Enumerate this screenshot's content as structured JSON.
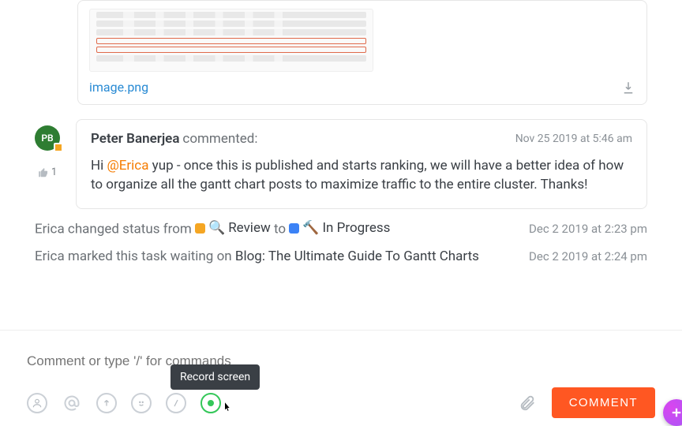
{
  "attachment": {
    "filename": "image.png"
  },
  "comment": {
    "avatar_initials": "PB",
    "author": "Peter Banerjea",
    "verb": "commented:",
    "timestamp": "Nov 25 2019 at 5:46 am",
    "body_prefix": "Hi ",
    "mention": "@Erica",
    "body_suffix": " yup - once this is published and starts ranking, we will have a better idea of how to organize all the gantt chart posts to maximize traffic to the entire cluster. Thanks!",
    "like_count": "1"
  },
  "activity1": {
    "actor": "Erica",
    "verb": " changed status from ",
    "from_status": "Review",
    "to_word": " to ",
    "to_status": "In Progress",
    "time": "Dec 2 2019 at 2:23 pm"
  },
  "activity2": {
    "actor": "Erica",
    "verb": " marked this task waiting on ",
    "target": "Blog: The Ultimate Guide To Gantt Charts",
    "time": "Dec 2 2019 at 2:24 pm"
  },
  "composer": {
    "placeholder": "Comment or type '/' for commands",
    "tooltip": "Record screen",
    "submit": "COMMENT"
  },
  "icons": {
    "magnify": "🔍",
    "hammer": "🔨"
  }
}
